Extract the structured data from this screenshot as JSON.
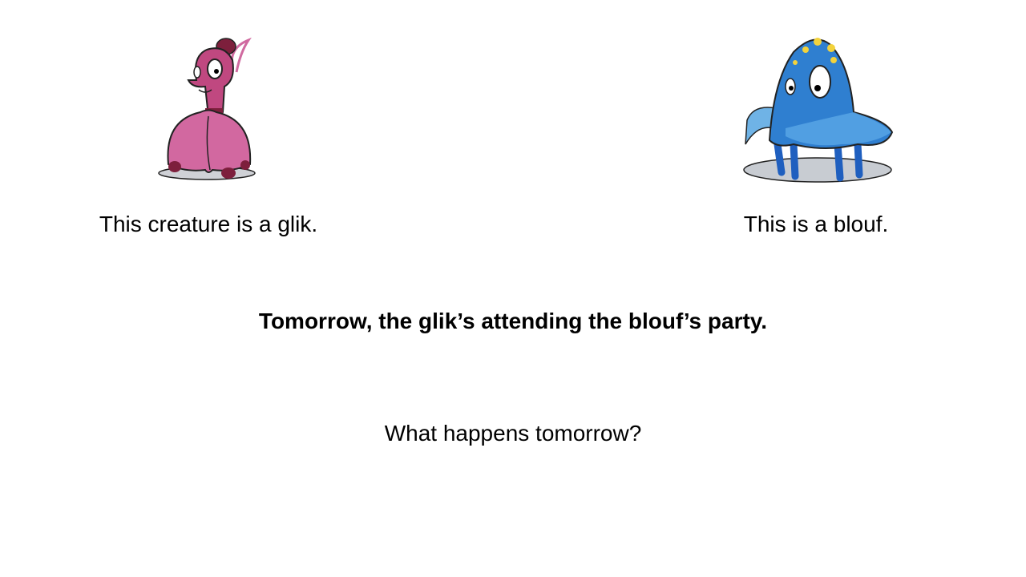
{
  "slide": {
    "glik_caption": "This creature is a glik.",
    "blouf_caption": "This is a blouf.",
    "statement": "Tomorrow, the glik’s attending the blouf’s party.",
    "question": "What happens tomorrow?"
  },
  "colors": {
    "glik_body": "#c9558f",
    "glik_dark": "#7d1f3c",
    "blouf_body": "#2f7fd0",
    "blouf_spots": "#f2d23c",
    "shadow": "#c8ccd2"
  }
}
